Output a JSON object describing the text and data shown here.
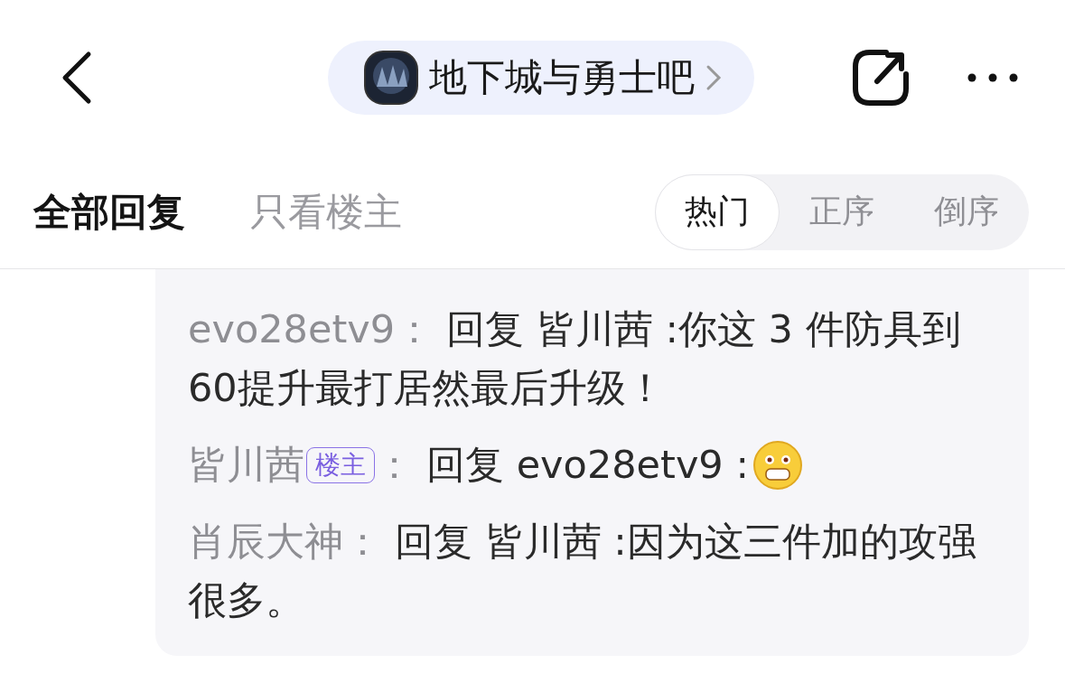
{
  "header": {
    "forum_name": "地下城与勇士吧"
  },
  "tabs": [
    {
      "label": "全部回复",
      "selected": true
    },
    {
      "label": "只看楼主",
      "selected": false
    }
  ],
  "sort_options": [
    {
      "label": "热门",
      "selected": true
    },
    {
      "label": "正序",
      "selected": false
    },
    {
      "label": "倒序",
      "selected": false
    }
  ],
  "replies": [
    {
      "author": "evo28etv9",
      "separator": "：",
      "text": "回复 皆川茜 :你这 3 件防具到60提升最打居然最后升级！"
    },
    {
      "author": "皆川茜",
      "badge": "楼主",
      "separator": "：",
      "text": "回复 evo28etv9 :",
      "emoji": true
    },
    {
      "author": "肖辰大神",
      "separator": "：",
      "text": "回复 皆川茜 :因为这三件加的攻强很多。"
    }
  ]
}
